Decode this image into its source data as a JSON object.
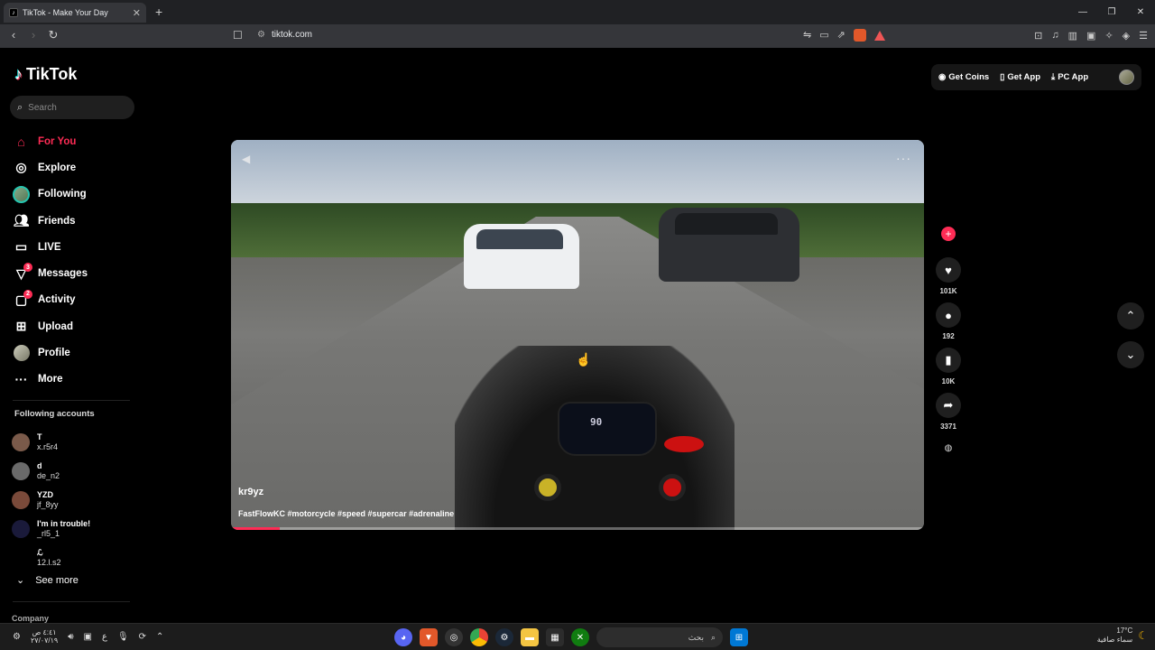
{
  "browser": {
    "tab_title": "TikTok - Make Your Day",
    "url": "tiktok.com",
    "window_controls": [
      "—",
      "❐",
      "✕"
    ]
  },
  "sidebar": {
    "logo_text": "TikTok",
    "search_placeholder": "Search",
    "menu": [
      {
        "label": "For You",
        "icon": "home-icon",
        "active": true
      },
      {
        "label": "Explore",
        "icon": "compass-icon"
      },
      {
        "label": "Following",
        "icon": "avatar"
      },
      {
        "label": "Friends",
        "icon": "friends-icon"
      },
      {
        "label": "LIVE",
        "icon": "live-icon"
      },
      {
        "label": "Messages",
        "icon": "messages-icon",
        "badge": "3"
      },
      {
        "label": "Activity",
        "icon": "activity-icon",
        "badge": "2"
      },
      {
        "label": "Upload",
        "icon": "upload-icon"
      },
      {
        "label": "Profile",
        "icon": "avatar"
      },
      {
        "label": "More",
        "icon": "more-icon"
      }
    ],
    "following_title": "Following accounts",
    "following": [
      {
        "name": "T",
        "username": "x.r5r4",
        "color": "#7a5a4a"
      },
      {
        "name": "d",
        "username": "de_n2",
        "color": "#6a6a6a"
      },
      {
        "name": "YZD",
        "username": "jf_8yy",
        "color": "#7a4a3a"
      },
      {
        "name": "I'm in trouble!",
        "username": "_rl5_1",
        "color": "#1a1a3a"
      },
      {
        "name": "ℒ",
        "username": "12.l.s2",
        "color": "#000000"
      }
    ],
    "see_more": "See more",
    "company": "Company"
  },
  "top_buttons": {
    "get_coins": "Get Coins",
    "get_app": "Get App",
    "pc_app": "PC App"
  },
  "video": {
    "author": "kr9yz",
    "description": "FastFlowKC #motorcycle #speed #supercar #adrenaline",
    "dashboard_speed": "90",
    "progress_percent": 7
  },
  "actions": {
    "likes": "101K",
    "comments": "192",
    "saves": "10K",
    "shares": "3371"
  },
  "taskbar": {
    "time": "٤:٤١ ص",
    "date": "٢٧/٠٧/١٩",
    "search_label": "بحث",
    "temperature": "17°C",
    "weather_text": "سماء صافية",
    "lang": "ع"
  },
  "colors": {
    "accent": "#fe2c55",
    "background": "#000000"
  }
}
